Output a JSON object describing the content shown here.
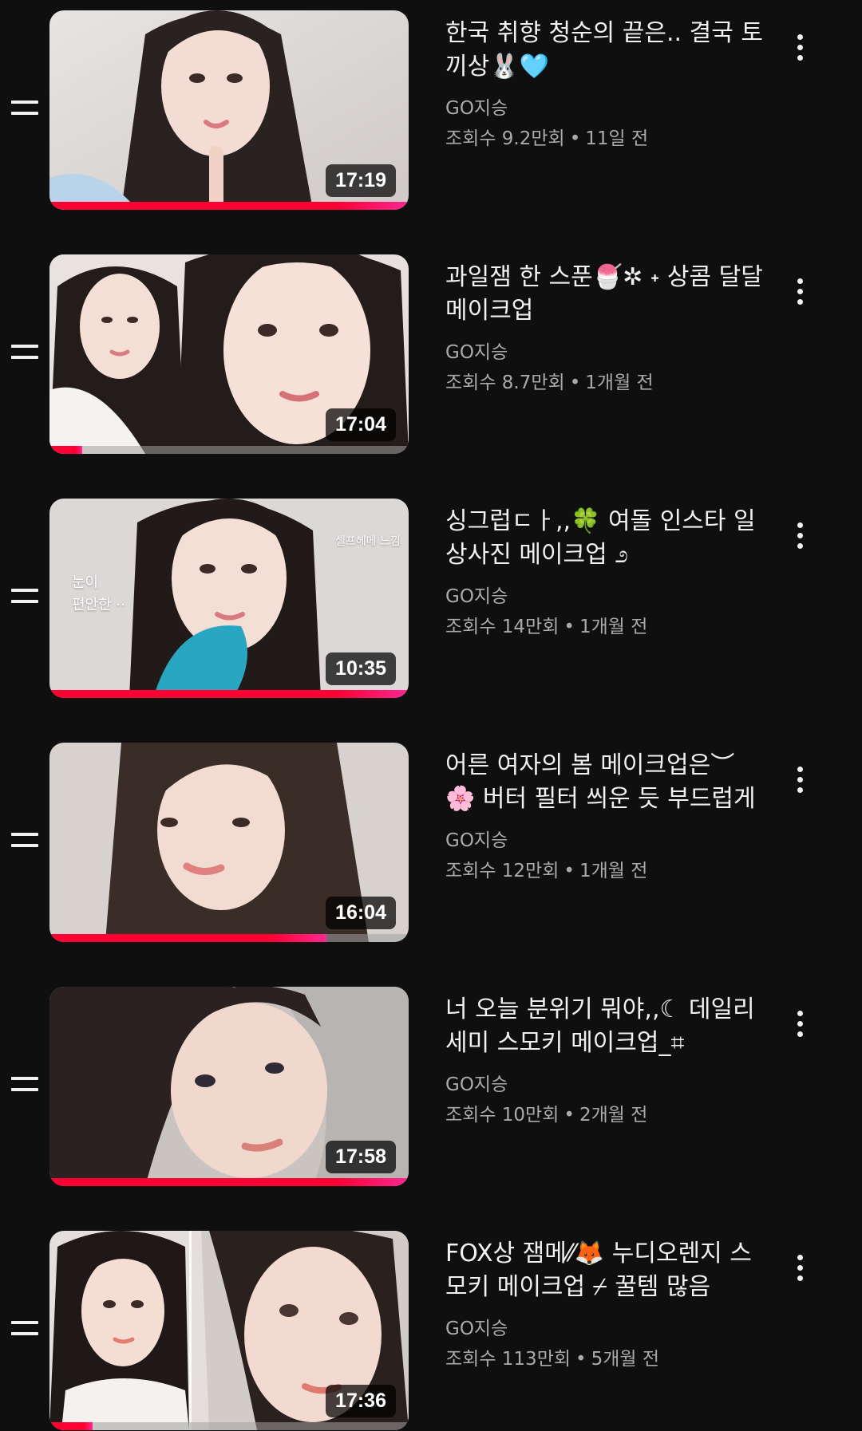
{
  "colors": {
    "background": "#0f0f0f",
    "text_primary": "#f1f1f1",
    "text_secondary": "#aaaaaa",
    "progress": "#ff0033"
  },
  "icons": {
    "drag_handle": "drag-handle-icon",
    "more": "more-vert-icon"
  },
  "videos": [
    {
      "title": "한국 취향 청순의 끝은.. 결국 토끼상🐰🩵",
      "channel": "GO지승",
      "views": "조회수 9.2만회",
      "age": "11일 전",
      "separator": "•",
      "duration": "17:19",
      "watched_fraction": 1.0
    },
    {
      "title": "과일잼 한 스푼🍧✲ ˖ 상콤 달달 메이크업",
      "channel": "GO지승",
      "views": "조회수 8.7만회",
      "age": "1개월 전",
      "separator": "•",
      "duration": "17:04",
      "watched_fraction": 0.09
    },
    {
      "title": "싱그럽ㄷㅏ,,🍀 여돌 인스타 일상사진 메이크업 ೨",
      "channel": "GO지승",
      "views": "조회수 14만회",
      "age": "1개월 전",
      "separator": "•",
      "duration": "10:35",
      "watched_fraction": 1.0,
      "overlay_left": "눈이\n편안한 ··",
      "overlay_right": "셀프헤메 느낌"
    },
    {
      "title": "어른 여자의 봄 메이크업은︶ 🌸 버터 필터 씌운 듯 부드럽게",
      "channel": "GO지승",
      "views": "조회수 12만회",
      "age": "1개월 전",
      "separator": "•",
      "duration": "16:04",
      "watched_fraction": 0.77
    },
    {
      "title": "너 오늘 분위기 뭐야,,☾ 데일리 세미 스모키 메이크업_⌗",
      "channel": "GO지승",
      "views": "조회수 10만회",
      "age": "2개월 전",
      "separator": "•",
      "duration": "17:58",
      "watched_fraction": 1.0
    },
    {
      "title": "FOX상 잼메⁄⁄🦊 누디오렌지 스모키 메이크업 ⌿ 꿀템 많음",
      "channel": "GO지승",
      "views": "조회수 113만회",
      "age": "5개월 전",
      "separator": "•",
      "duration": "17:36",
      "watched_fraction": 0.12
    }
  ]
}
